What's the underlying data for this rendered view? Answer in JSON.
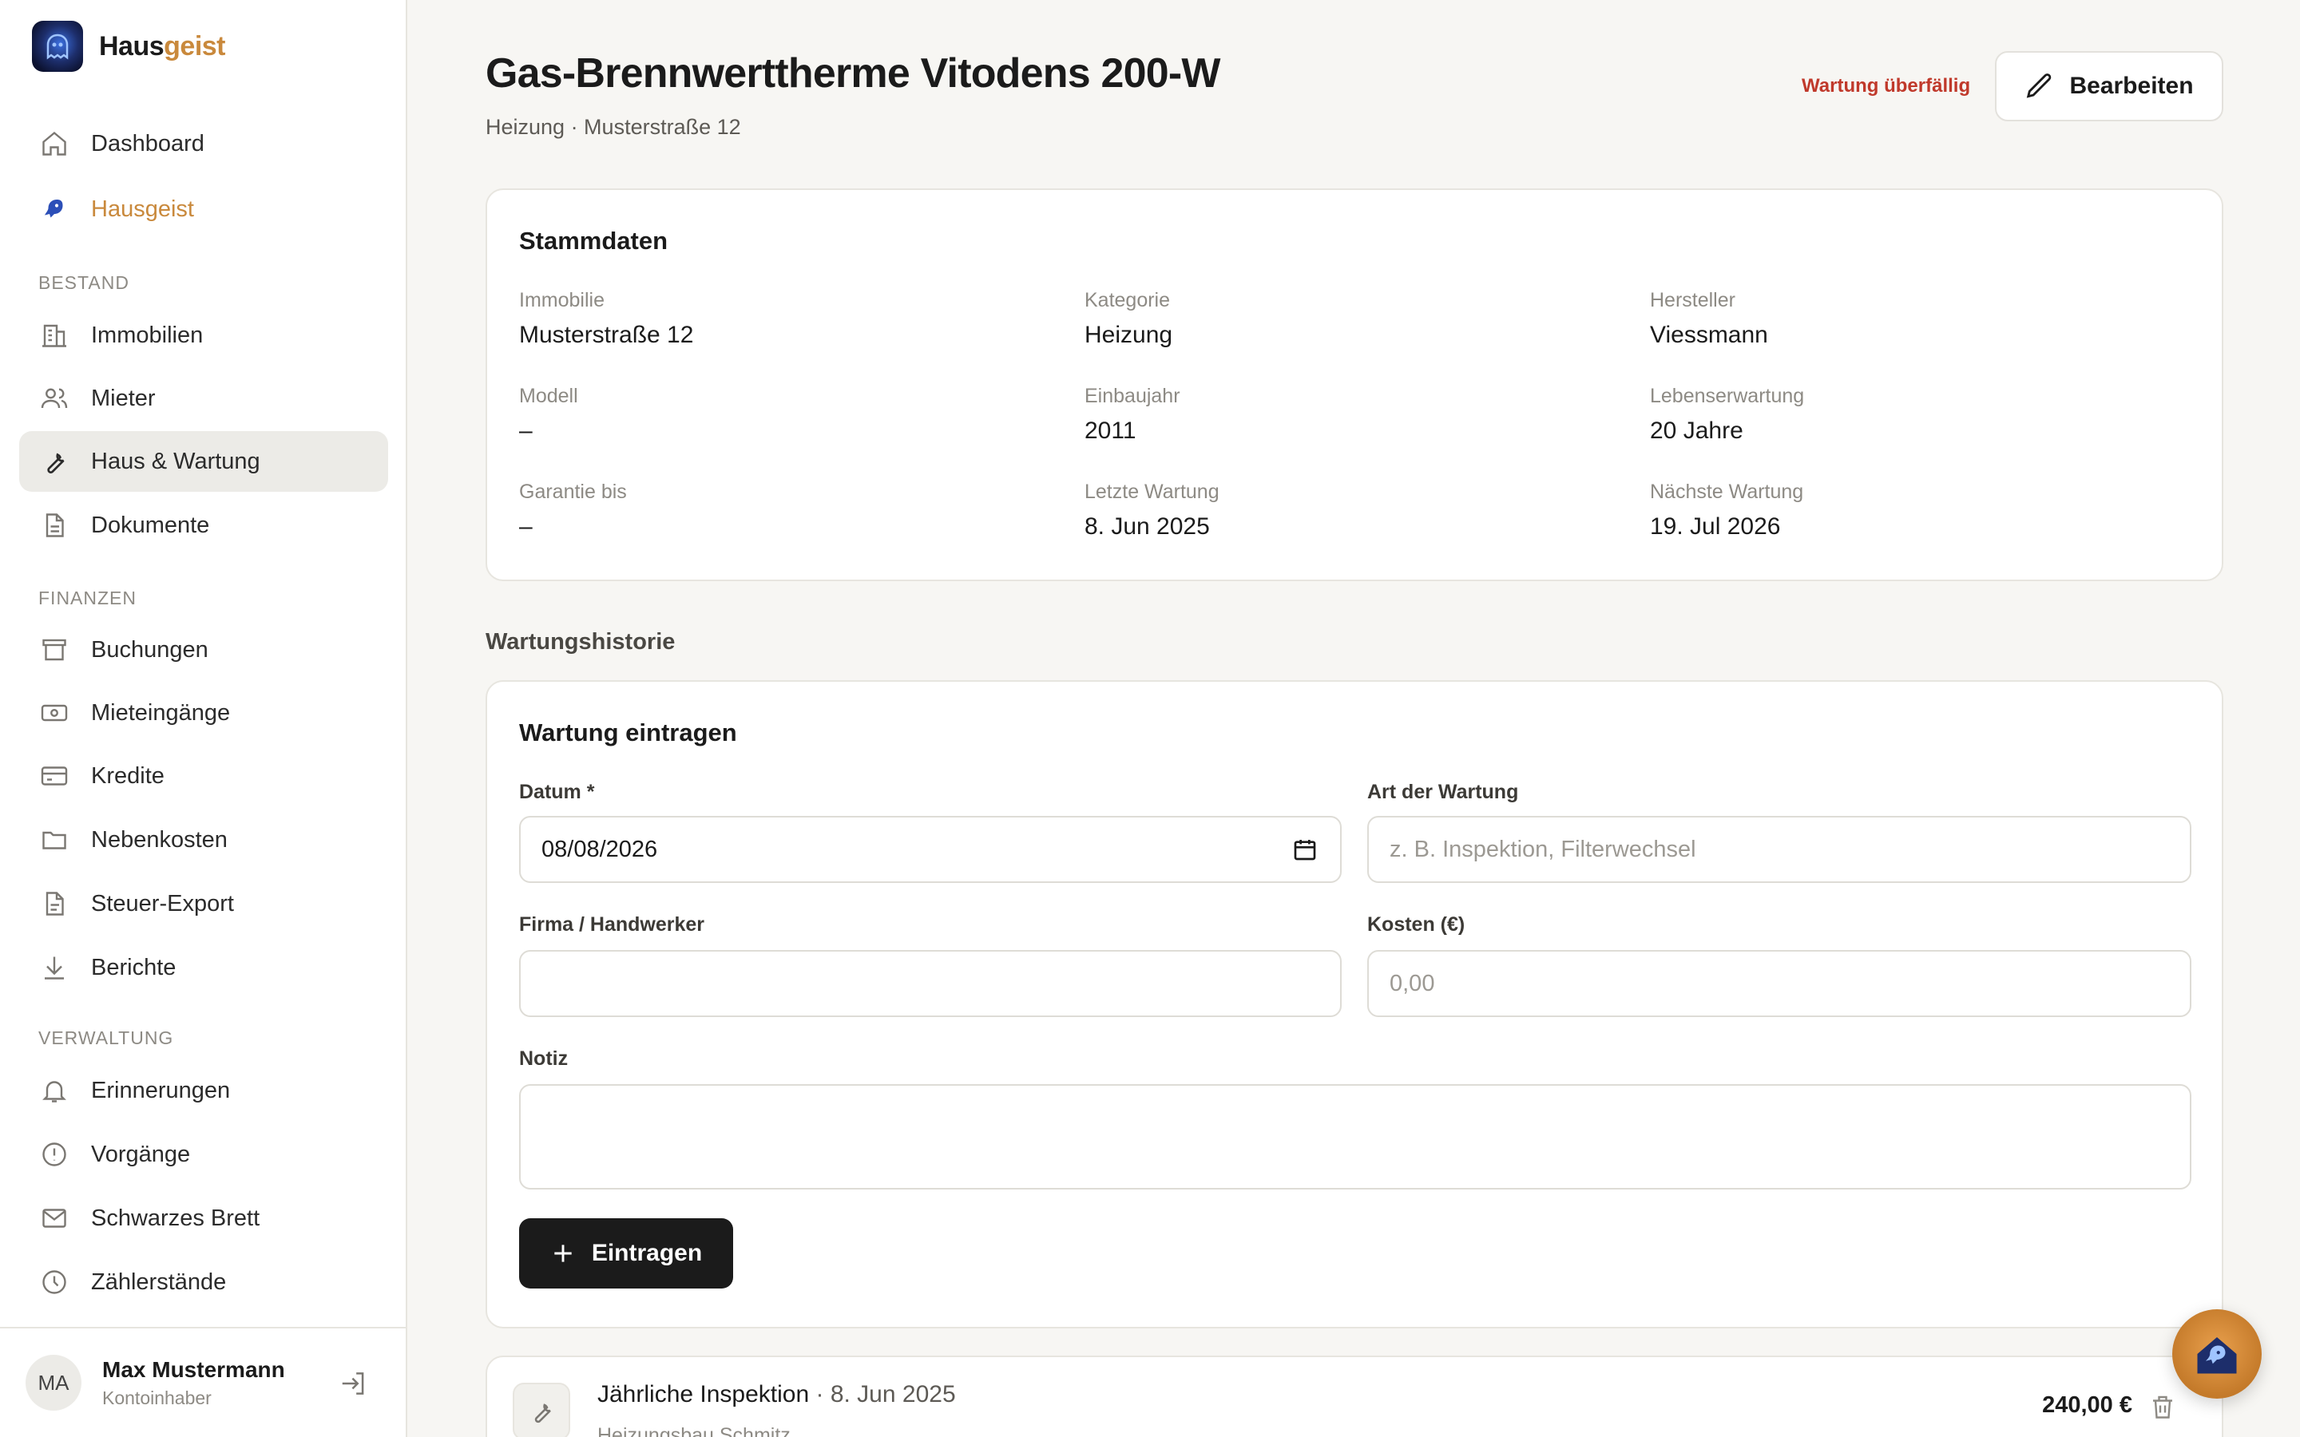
{
  "brand": {
    "name_main": "Haus",
    "name_accent": "geist"
  },
  "sidebar": {
    "top_items": [
      {
        "label": "Dashboard",
        "icon": "home-icon"
      },
      {
        "label": "Hausgeist",
        "icon": "ghost-icon"
      }
    ],
    "sections": [
      {
        "title": "BESTAND",
        "items": [
          {
            "label": "Immobilien",
            "icon": "building-icon"
          },
          {
            "label": "Mieter",
            "icon": "users-icon"
          },
          {
            "label": "Haus & Wartung",
            "icon": "wrench-icon",
            "active": true
          },
          {
            "label": "Dokumente",
            "icon": "document-icon"
          }
        ]
      },
      {
        "title": "FINANZEN",
        "items": [
          {
            "label": "Buchungen",
            "icon": "archive-icon"
          },
          {
            "label": "Mieteingänge",
            "icon": "banknote-icon"
          },
          {
            "label": "Kredite",
            "icon": "credit-card-icon"
          },
          {
            "label": "Nebenkosten",
            "icon": "folder-icon"
          },
          {
            "label": "Steuer-Export",
            "icon": "file-text-icon"
          },
          {
            "label": "Berichte",
            "icon": "download-icon"
          }
        ]
      },
      {
        "title": "VERWALTUNG",
        "items": [
          {
            "label": "Erinnerungen",
            "icon": "bell-icon"
          },
          {
            "label": "Vorgänge",
            "icon": "alert-circle-icon"
          },
          {
            "label": "Schwarzes Brett",
            "icon": "mail-icon"
          },
          {
            "label": "Zählerstände",
            "icon": "clock-icon"
          }
        ]
      }
    ],
    "user": {
      "initials": "MA",
      "name": "Max Mustermann",
      "role": "Kontoinhaber"
    }
  },
  "header": {
    "title": "Gas-Brennwerttherme Vitodens 200-W",
    "subtitle": "Heizung · Musterstraße 12",
    "status": "Wartung überfällig",
    "edit_label": "Bearbeiten"
  },
  "stammdaten": {
    "title": "Stammdaten",
    "fields": [
      {
        "label": "Immobilie",
        "value": "Musterstraße 12"
      },
      {
        "label": "Kategorie",
        "value": "Heizung"
      },
      {
        "label": "Hersteller",
        "value": "Viessmann"
      },
      {
        "label": "Modell",
        "value": "–"
      },
      {
        "label": "Einbaujahr",
        "value": "2011"
      },
      {
        "label": "Lebenserwartung",
        "value": "20 Jahre"
      },
      {
        "label": "Garantie bis",
        "value": "–"
      },
      {
        "label": "Letzte Wartung",
        "value": "8. Jun 2025"
      },
      {
        "label": "Nächste Wartung",
        "value": "19. Jul 2026"
      }
    ]
  },
  "history": {
    "section_title": "Wartungshistorie",
    "form": {
      "title": "Wartung eintragen",
      "date_label": "Datum *",
      "date_value": "08/08/2026",
      "type_label": "Art der Wartung",
      "type_placeholder": "z. B. Inspektion, Filterwechsel",
      "company_label": "Firma / Handwerker",
      "company_value": "",
      "cost_label": "Kosten (€)",
      "cost_placeholder": "0,00",
      "note_label": "Notiz",
      "submit_label": "Eintragen"
    },
    "entries": [
      {
        "title": "Jährliche Inspektion",
        "date": "· 8. Jun 2025",
        "company": "Heizungsbau Schmitz",
        "cost": "240,00 €"
      }
    ]
  },
  "colors": {
    "accent": "#c9893c",
    "danger": "#c0392b",
    "primary": "#1b1b1b"
  }
}
